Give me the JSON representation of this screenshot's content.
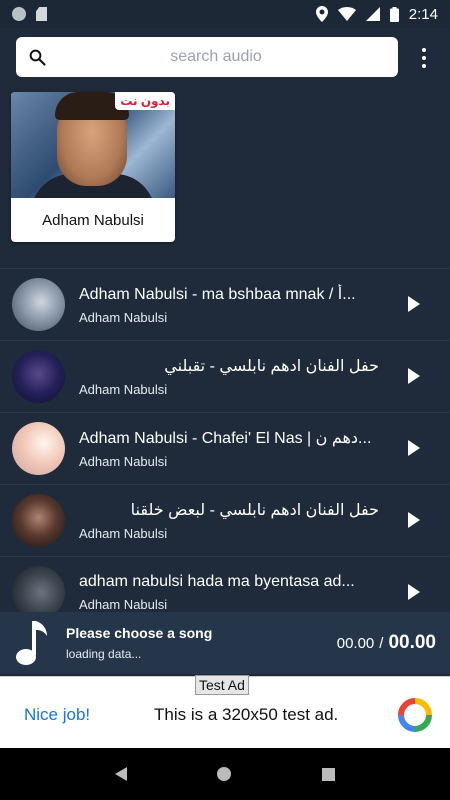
{
  "status_bar": {
    "time": "2:14"
  },
  "search": {
    "placeholder": "search audio"
  },
  "artist_card": {
    "name": "Adham Nabulsi",
    "badge": "بدون نت"
  },
  "songs": [
    {
      "title": "Adham Nabulsi - ma bshbaa mnak / أ...",
      "artist": "Adham Nabulsi",
      "rtl": false
    },
    {
      "title": "حفل الفنان ادهم نابلسي - تقبلني",
      "artist": "Adham Nabulsi",
      "rtl": true
    },
    {
      "title": "Adham Nabulsi - Chafei' El Nas | دهم ن...",
      "artist": "Adham Nabulsi",
      "rtl": false
    },
    {
      "title": "حفل الفنان ادهم نابلسي - لبعض خلقنا",
      "artist": "Adham Nabulsi",
      "rtl": true
    },
    {
      "title": "adham nabulsi hada ma byentasa ad...",
      "artist": "Adham Nabulsi",
      "rtl": false
    }
  ],
  "player": {
    "title": "Please choose a song",
    "subtitle": "loading data...",
    "time_current": "00.00",
    "time_separator": "/",
    "time_total": "00.00"
  },
  "ad": {
    "label": "Test Ad",
    "nice": "Nice job!",
    "text": "This is a 320x50 test ad."
  },
  "colors": {
    "background": "#1f2b3a",
    "player_bar": "#25354a",
    "ad_link": "#1a73e8"
  }
}
